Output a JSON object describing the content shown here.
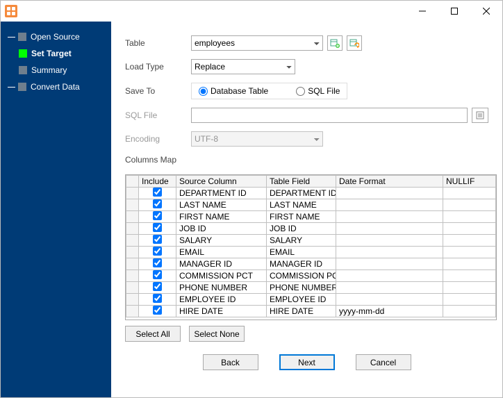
{
  "nav": {
    "items": [
      {
        "label": "Open Source",
        "active": false,
        "child": false
      },
      {
        "label": "Set Target",
        "active": true,
        "child": true
      },
      {
        "label": "Summary",
        "active": false,
        "child": true
      },
      {
        "label": "Convert Data",
        "active": false,
        "child": false
      }
    ]
  },
  "form": {
    "table_label": "Table",
    "table_value": "employees",
    "load_label": "Load Type",
    "load_value": "Replace",
    "save_label": "Save To",
    "save_db": "Database Table",
    "save_sql": "SQL File",
    "sqlfile_label": "SQL File",
    "encoding_label": "Encoding",
    "encoding_value": "UTF-8",
    "columns_title": "Columns Map"
  },
  "grid": {
    "headers": {
      "include": "Include",
      "source": "Source Column",
      "field": "Table Field",
      "date": "Date Format",
      "nullif": "NULLIF"
    },
    "rows": [
      {
        "inc": true,
        "src": "DEPARTMENT ID",
        "fld": "DEPARTMENT ID",
        "dfmt": "",
        "nul": ""
      },
      {
        "inc": true,
        "src": "LAST NAME",
        "fld": "LAST NAME",
        "dfmt": "",
        "nul": ""
      },
      {
        "inc": true,
        "src": "FIRST NAME",
        "fld": "FIRST NAME",
        "dfmt": "",
        "nul": ""
      },
      {
        "inc": true,
        "src": "JOB ID",
        "fld": "JOB ID",
        "dfmt": "",
        "nul": ""
      },
      {
        "inc": true,
        "src": "SALARY",
        "fld": "SALARY",
        "dfmt": "",
        "nul": ""
      },
      {
        "inc": true,
        "src": "EMAIL",
        "fld": "EMAIL",
        "dfmt": "",
        "nul": ""
      },
      {
        "inc": true,
        "src": "MANAGER ID",
        "fld": "MANAGER ID",
        "dfmt": "",
        "nul": ""
      },
      {
        "inc": true,
        "src": "COMMISSION PCT",
        "fld": "COMMISSION PCT",
        "dfmt": "",
        "nul": ""
      },
      {
        "inc": true,
        "src": "PHONE NUMBER",
        "fld": "PHONE NUMBER",
        "dfmt": "",
        "nul": ""
      },
      {
        "inc": true,
        "src": "EMPLOYEE ID",
        "fld": "EMPLOYEE ID",
        "dfmt": "",
        "nul": ""
      },
      {
        "inc": true,
        "src": "HIRE DATE",
        "fld": "HIRE DATE",
        "dfmt": "yyyy-mm-dd",
        "nul": ""
      }
    ]
  },
  "buttons": {
    "select_all": "Select All",
    "select_none": "Select None",
    "back": "Back",
    "next": "Next",
    "cancel": "Cancel"
  }
}
